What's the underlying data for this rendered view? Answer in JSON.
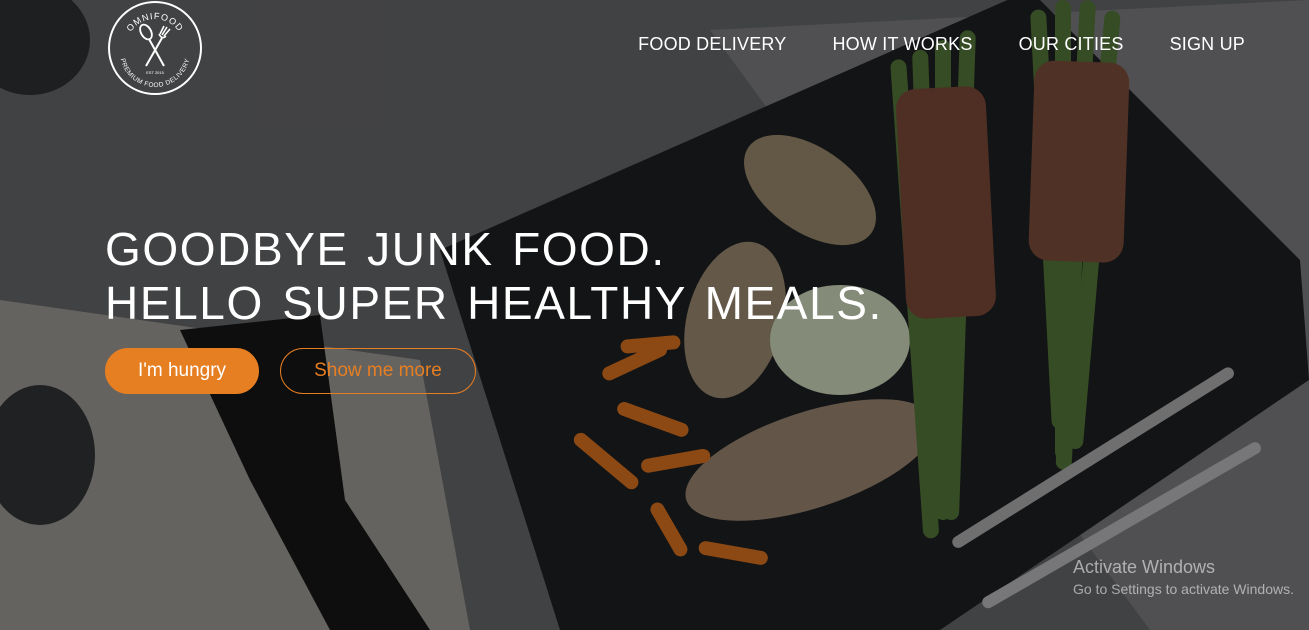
{
  "logo": {
    "top_text": "OMNIFOOD",
    "bottom_text": "PREMIUM FOOD DELIVERY",
    "est_text": "EST 2015"
  },
  "nav": {
    "items": [
      {
        "label": "FOOD DELIVERY"
      },
      {
        "label": "HOW IT WORKS"
      },
      {
        "label": "OUR CITIES"
      },
      {
        "label": "SIGN UP"
      }
    ]
  },
  "hero": {
    "headline_line1": "GOODBYE JUNK FOOD.",
    "headline_line2": "HELLO SUPER HEALTHY MEALS.",
    "primary_button": "I'm hungry",
    "secondary_button": "Show me more"
  },
  "watermark": {
    "title": "Activate Windows",
    "subtitle": "Go to Settings to activate Windows."
  },
  "colors": {
    "accent": "#e67e22",
    "text": "#ffffff"
  }
}
